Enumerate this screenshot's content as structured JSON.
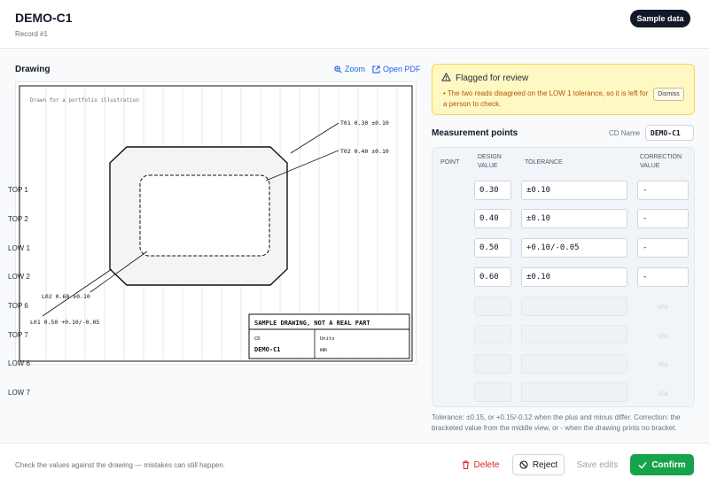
{
  "header": {
    "title": "DEMO-C1",
    "subtitle": "Record #1",
    "sample_button": "Sample data"
  },
  "drawing_panel": {
    "label": "Drawing",
    "zoom_label": "Zoom",
    "open_pdf_label": "Open PDF",
    "note": "Drawn for a portfolio illustration",
    "callouts": {
      "t01": "T01 0.30 ±0.10",
      "t02": "T02 0.40 ±0.10",
      "l02": "L02 0.60 ±0.10",
      "l01": "L01 0.50 +0.10/-0.05"
    },
    "title_block": {
      "heading": "SAMPLE DRAWING, NOT A REAL PART",
      "cd_label": "CD",
      "cd_value": "DEMO-C1",
      "units_label": "Units",
      "units_value": "mm"
    }
  },
  "flag": {
    "title": "Flagged for review",
    "message": "• The two reads disagreed on the LOW 1 tolerance, so it is left for a person to check.",
    "dismiss_label": "Dismiss",
    "icon": "warning-triangle-icon",
    "color": "#b45309"
  },
  "measurements": {
    "title": "Measurement points",
    "cd_name_label": "CD Name",
    "cd_name_value": "DEMO-C1",
    "columns": {
      "point": "POINT",
      "design_value": "DESIGN VALUE",
      "tolerance": "TOLERANCE",
      "correction_value": "CORRECTION VALUE"
    },
    "rows": [
      {
        "point": "TOP 1",
        "design": "0.30",
        "tolerance": "±0.10",
        "correction": "-"
      },
      {
        "point": "TOP 2",
        "design": "0.40",
        "tolerance": "±0.10",
        "correction": "-"
      },
      {
        "point": "LOW 1",
        "design": "0.50",
        "tolerance": "+0.10/-0.05",
        "correction": "-"
      },
      {
        "point": "LOW 2",
        "design": "0.60",
        "tolerance": "±0.10",
        "correction": "-"
      },
      {
        "point": "TOP 6",
        "design": "",
        "tolerance": "",
        "correction": "n/a"
      },
      {
        "point": "TOP 7",
        "design": "",
        "tolerance": "",
        "correction": "n/a"
      },
      {
        "point": "LOW 6",
        "design": "",
        "tolerance": "",
        "correction": "n/a"
      },
      {
        "point": "LOW 7",
        "design": "",
        "tolerance": "",
        "correction": "n/a"
      }
    ],
    "footnote": "Tolerance: ±0.15, or +0.15/-0.12 when the plus and minus differ. Correction: the bracketed value from the middle view, or - when the drawing prints no bracket."
  },
  "footer": {
    "note": "Check the values against the drawing — mistakes can still happen.",
    "delete_label": "Delete",
    "reject_label": "Reject",
    "save_label": "Save edits",
    "confirm_label": "Confirm",
    "accent": "#16a34a",
    "danger": "#dc2626"
  }
}
